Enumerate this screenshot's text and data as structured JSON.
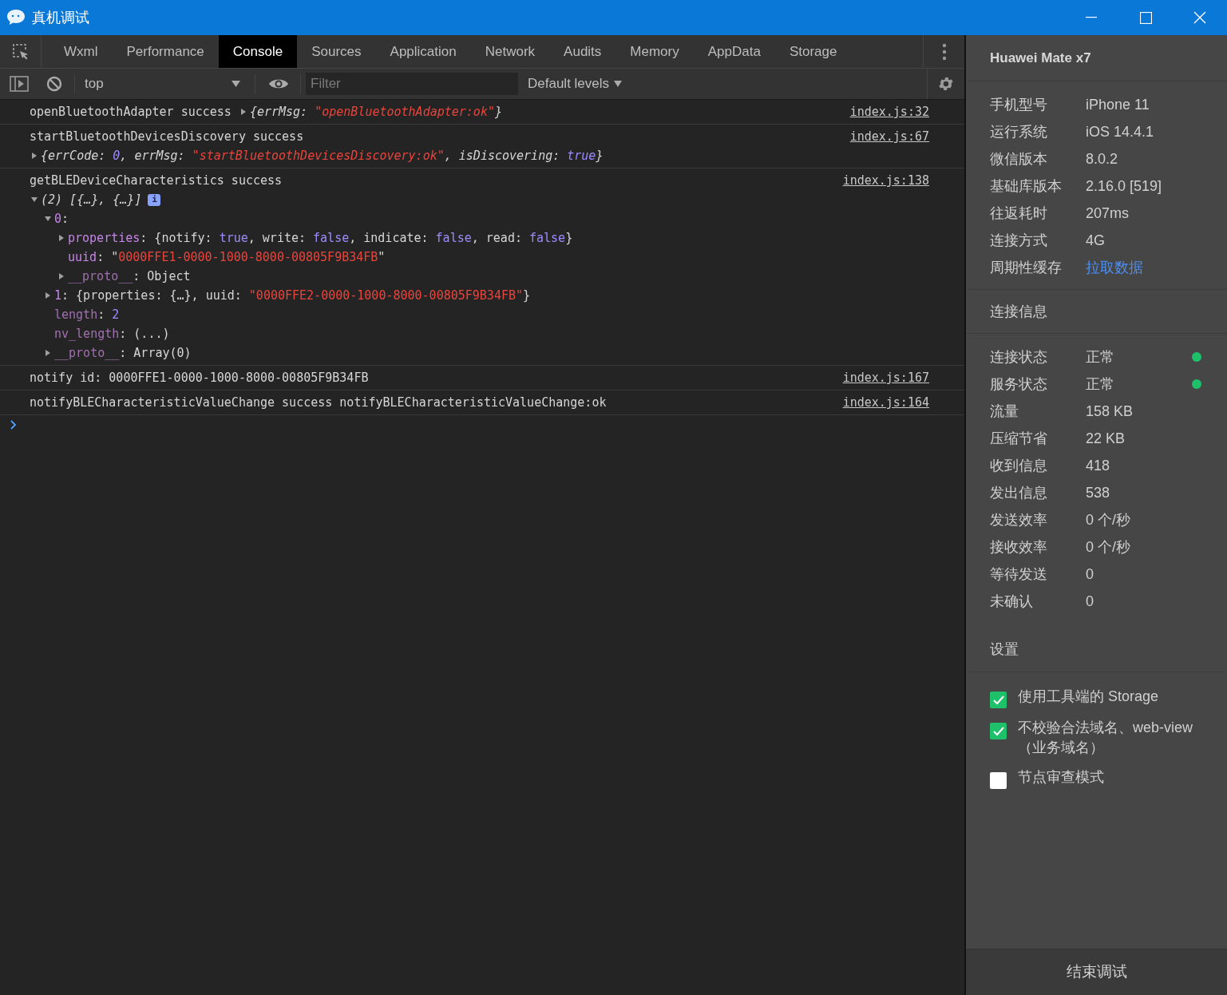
{
  "window": {
    "title": "真机调试"
  },
  "tabs": [
    {
      "label": "Wxml",
      "selected": false
    },
    {
      "label": "Performance",
      "selected": false
    },
    {
      "label": "Console",
      "selected": true
    },
    {
      "label": "Sources",
      "selected": false
    },
    {
      "label": "Application",
      "selected": false
    },
    {
      "label": "Network",
      "selected": false
    },
    {
      "label": "Audits",
      "selected": false
    },
    {
      "label": "Memory",
      "selected": false
    },
    {
      "label": "AppData",
      "selected": false
    },
    {
      "label": "Storage",
      "selected": false
    }
  ],
  "toolbar": {
    "context": "top",
    "filter": {
      "placeholder": "Filter"
    },
    "levels": "Default levels"
  },
  "console": [
    {
      "source": "index.js:32",
      "lines": [
        {
          "tokens": [
            {
              "kind": "plain",
              "text": "openBluetoothAdapter success "
            },
            {
              "kind": "toggle",
              "expanded": false
            },
            {
              "kind": "plain",
              "text": "{errMsg: ",
              "italic": true
            },
            {
              "kind": "str",
              "text": "\"openBluetoothAdapter:ok\"",
              "italic": true
            },
            {
              "kind": "plain",
              "text": "}",
              "italic": true
            }
          ]
        }
      ]
    },
    {
      "source": "index.js:67",
      "lines": [
        {
          "tokens": [
            {
              "kind": "plain",
              "text": "startBluetoothDevicesDiscovery success"
            }
          ]
        },
        {
          "tokens": [
            {
              "kind": "toggle",
              "expanded": false
            },
            {
              "kind": "plain",
              "text": "{errCode: ",
              "italic": true
            },
            {
              "kind": "kw",
              "text": "0",
              "italic": true
            },
            {
              "kind": "plain",
              "text": ", errMsg: ",
              "italic": true
            },
            {
              "kind": "str",
              "text": "\"startBluetoothDevicesDiscovery:ok\"",
              "italic": true
            },
            {
              "kind": "plain",
              "text": ", isDiscovering: ",
              "italic": true
            },
            {
              "kind": "kw",
              "text": "true",
              "italic": true
            },
            {
              "kind": "plain",
              "text": "}",
              "italic": true
            }
          ]
        }
      ]
    },
    {
      "source": "index.js:138",
      "lines": [
        {
          "tokens": [
            {
              "kind": "plain",
              "text": "getBLEDeviceCharacteristics success"
            }
          ]
        },
        {
          "tokens": [
            {
              "kind": "toggle",
              "expanded": true
            },
            {
              "kind": "plain",
              "text": "(2) [{…}, {…}]",
              "italic": true
            },
            {
              "kind": "badge",
              "text": "i"
            }
          ],
          "children": [
            {
              "tokens": [
                {
                  "kind": "toggle",
                  "expanded": true
                },
                {
                  "kind": "key",
                  "text": "0"
                },
                {
                  "kind": "plain",
                  "text": ":"
                }
              ],
              "children": [
                {
                  "tokens": [
                    {
                      "kind": "toggle",
                      "expanded": false
                    },
                    {
                      "kind": "key",
                      "text": "properties"
                    },
                    {
                      "kind": "plain",
                      "text": ": {notify: "
                    },
                    {
                      "kind": "kw",
                      "text": "true"
                    },
                    {
                      "kind": "plain",
                      "text": ", write: "
                    },
                    {
                      "kind": "kw",
                      "text": "false"
                    },
                    {
                      "kind": "plain",
                      "text": ", indicate: "
                    },
                    {
                      "kind": "kw",
                      "text": "false"
                    },
                    {
                      "kind": "plain",
                      "text": ", read: "
                    },
                    {
                      "kind": "kw",
                      "text": "false"
                    },
                    {
                      "kind": "plain",
                      "text": "}"
                    }
                  ]
                },
                {
                  "tokens": [
                    {
                      "kind": "key",
                      "text": "uuid"
                    },
                    {
                      "kind": "plain",
                      "text": ": \""
                    },
                    {
                      "kind": "str",
                      "text": "0000FFE1-0000-1000-8000-00805F9B34FB"
                    },
                    {
                      "kind": "plain",
                      "text": "\""
                    }
                  ]
                },
                {
                  "tokens": [
                    {
                      "kind": "toggle",
                      "expanded": false
                    },
                    {
                      "kind": "dim",
                      "text": "__proto__"
                    },
                    {
                      "kind": "plain",
                      "text": ": Object"
                    }
                  ]
                }
              ]
            },
            {
              "tokens": [
                {
                  "kind": "toggle",
                  "expanded": false
                },
                {
                  "kind": "key",
                  "text": "1"
                },
                {
                  "kind": "plain",
                  "text": ": {properties: {…}, uuid: "
                },
                {
                  "kind": "str",
                  "text": "\"0000FFE2-0000-1000-8000-00805F9B34FB\""
                },
                {
                  "kind": "plain",
                  "text": "}"
                }
              ]
            },
            {
              "tokens": [
                {
                  "kind": "dim",
                  "text": "length"
                },
                {
                  "kind": "plain",
                  "text": ": "
                },
                {
                  "kind": "kw",
                  "text": "2"
                }
              ]
            },
            {
              "tokens": [
                {
                  "kind": "dim",
                  "text": "nv_length"
                },
                {
                  "kind": "plain",
                  "text": ": (...)"
                }
              ]
            },
            {
              "tokens": [
                {
                  "kind": "toggle",
                  "expanded": false
                },
                {
                  "kind": "dim",
                  "text": "__proto__"
                },
                {
                  "kind": "plain",
                  "text": ": Array(0)"
                }
              ]
            }
          ]
        }
      ]
    },
    {
      "source": "index.js:167",
      "lines": [
        {
          "tokens": [
            {
              "kind": "plain",
              "text": "notify id: 0000FFE1-0000-1000-8000-00805F9B34FB"
            }
          ]
        }
      ]
    },
    {
      "source": "index.js:164",
      "lines": [
        {
          "tokens": [
            {
              "kind": "plain",
              "text": "notifyBLECharacteristicValueChange success notifyBLECharacteristicValueChange:ok"
            }
          ]
        }
      ]
    }
  ],
  "device": {
    "name": "Huawei Mate x7",
    "info": [
      {
        "label": "手机型号",
        "value": "iPhone 11",
        "kind": "text"
      },
      {
        "label": "运行系统",
        "value": "iOS 14.4.1",
        "kind": "text"
      },
      {
        "label": "微信版本",
        "value": "8.0.2",
        "kind": "text"
      },
      {
        "label": "基础库版本",
        "value": "2.16.0 [519]",
        "kind": "text"
      },
      {
        "label": "往返耗时",
        "value": "207ms",
        "kind": "text"
      },
      {
        "label": "连接方式",
        "value": "4G",
        "kind": "text"
      },
      {
        "label": "周期性缓存",
        "value": "拉取数据",
        "kind": "link"
      }
    ]
  },
  "connection": {
    "title": "连接信息",
    "rows": [
      {
        "label": "连接状态",
        "value": "正常",
        "color": "#1fc06a"
      },
      {
        "label": "服务状态",
        "value": "正常",
        "color": "#1fc06a"
      },
      {
        "label": "流量",
        "value": "158 KB"
      },
      {
        "label": "压缩节省",
        "value": "22 KB"
      },
      {
        "label": "收到信息",
        "value": "418"
      },
      {
        "label": "发出信息",
        "value": "538"
      },
      {
        "label": "发送效率",
        "value": "0 个/秒"
      },
      {
        "label": "接收效率",
        "value": "0 个/秒"
      },
      {
        "label": "等待发送",
        "value": "0"
      },
      {
        "label": "未确认",
        "value": "0"
      }
    ]
  },
  "settings": {
    "title": "设置",
    "options": [
      {
        "label": "使用工具端的 Storage",
        "checked": true
      },
      {
        "label": "不校验合法域名、web-view（业务域名）",
        "checked": true
      },
      {
        "label": "节点审查模式",
        "checked": false
      }
    ]
  },
  "end_button": "结束调试"
}
